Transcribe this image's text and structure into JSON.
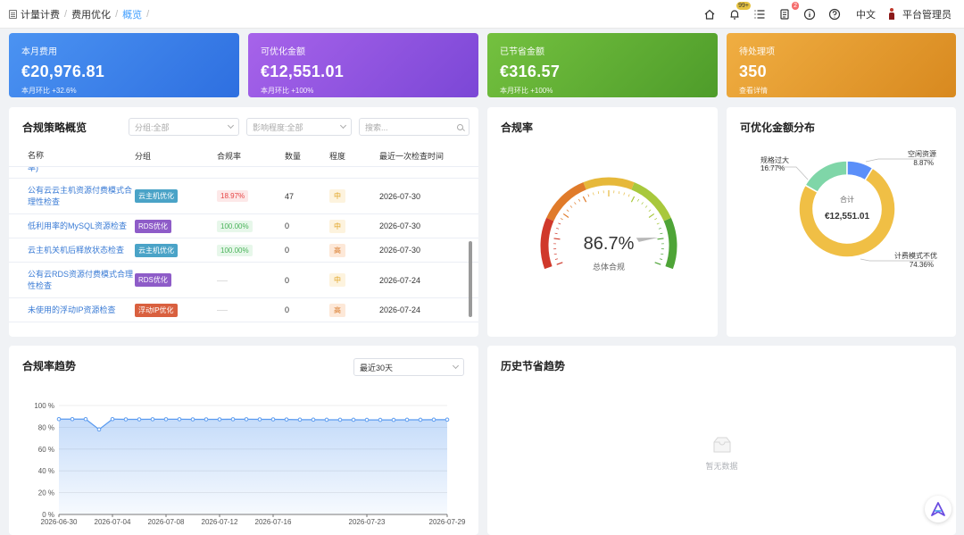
{
  "breadcrumb": {
    "root": "计量计费",
    "mid": "费用优化",
    "current": "概览",
    "sep": "/"
  },
  "header": {
    "badge_bell": "99+",
    "badge_doc": "2",
    "lang": "中文",
    "user": "平台管理员"
  },
  "kpis": [
    {
      "label": "本月费用",
      "value": "€20,976.81",
      "sub": "本月环比 +32.6%"
    },
    {
      "label": "可优化金额",
      "value": "€12,551.01",
      "sub": "本月环比 +100%"
    },
    {
      "label": "已节省金额",
      "value": "€316.57",
      "sub": "本月环比 +100%"
    },
    {
      "label": "待处理项",
      "value": "350",
      "sub": "查看详情"
    }
  ],
  "compliance": {
    "title": "合规策略概览",
    "filter_group": "分组:全部",
    "filter_impact": "影响程度:全部",
    "search_placeholder": "搜索...",
    "columns": [
      "名称",
      "分组",
      "合规率",
      "数量",
      "程度",
      "最近一次检查时间"
    ],
    "rows": [
      {
        "name": "率)",
        "group": "",
        "group_type": "cloud",
        "rate": "",
        "rate_type": "green",
        "count": "",
        "level": "",
        "level_type": "mid",
        "time": ""
      },
      {
        "name": "公有云云主机资源付费模式合理性检查",
        "group": "云主机优化",
        "group_type": "cloud",
        "rate": "18.97%",
        "rate_type": "red",
        "count": "47",
        "level": "中",
        "level_type": "mid",
        "time": "2026-07-30"
      },
      {
        "name": "低利用率的MySQL资源检查",
        "group": "RDS优化",
        "group_type": "rds",
        "rate": "100.00%",
        "rate_type": "green",
        "count": "0",
        "level": "中",
        "level_type": "mid",
        "time": "2026-07-30"
      },
      {
        "name": "云主机关机后释放状态检查",
        "group": "云主机优化",
        "group_type": "cloud",
        "rate": "100.00%",
        "rate_type": "green",
        "count": "0",
        "level": "高",
        "level_type": "high",
        "time": "2026-07-30"
      },
      {
        "name": "公有云RDS资源付费模式合理性检查",
        "group": "RDS优化",
        "group_type": "rds",
        "rate": "",
        "rate_type": "none",
        "count": "0",
        "level": "中",
        "level_type": "mid",
        "time": "2026-07-24"
      },
      {
        "name": "未使用的浮动IP资源检查",
        "group": "浮动IP优化",
        "group_type": "ip",
        "rate": "",
        "rate_type": "none",
        "count": "0",
        "level": "高",
        "level_type": "high",
        "time": "2026-07-24"
      }
    ]
  },
  "gauge": {
    "title": "合规率",
    "value": 86.7,
    "value_text": "86.7%",
    "label": "总体合规"
  },
  "distribution": {
    "title": "可优化金额分布",
    "center_label": "合计",
    "center_value": "€12,551.01",
    "slices": [
      {
        "name": "空闲资源",
        "percent": 8.87,
        "percent_text": "8.87%",
        "color": "#5b8ff9"
      },
      {
        "name": "计费模式不优",
        "percent": 74.36,
        "percent_text": "74.36%",
        "color": "#f0bf45"
      },
      {
        "name": "规格过大",
        "percent": 16.77,
        "percent_text": "16.77%",
        "color": "#7fd6a8"
      }
    ]
  },
  "trend": {
    "title": "合规率趋势",
    "range": "最近30天"
  },
  "history": {
    "title": "历史节省趋势",
    "empty": "暂无数据"
  },
  "chart_data": {
    "type": "area",
    "title": "合规率趋势",
    "xlabel": "",
    "ylabel": "",
    "ylim": [
      0,
      100
    ],
    "y_ticks": [
      "0 %",
      "20 %",
      "40 %",
      "60 %",
      "80 %",
      "100 %"
    ],
    "x_ticks": [
      "2026-06-30",
      "2026-07-04",
      "2026-07-08",
      "2026-07-12",
      "2026-07-16",
      "2026-07-23",
      "2026-07-29"
    ],
    "x": [
      "2026-06-30",
      "2026-07-01",
      "2026-07-02",
      "2026-07-03",
      "2026-07-04",
      "2026-07-05",
      "2026-07-06",
      "2026-07-07",
      "2026-07-08",
      "2026-07-09",
      "2026-07-10",
      "2026-07-11",
      "2026-07-12",
      "2026-07-13",
      "2026-07-14",
      "2026-07-15",
      "2026-07-16",
      "2026-07-17",
      "2026-07-18",
      "2026-07-19",
      "2026-07-20",
      "2026-07-21",
      "2026-07-22",
      "2026-07-23",
      "2026-07-24",
      "2026-07-25",
      "2026-07-26",
      "2026-07-27",
      "2026-07-28",
      "2026-07-29"
    ],
    "series": [
      {
        "values": [
          87.5,
          87.5,
          87.5,
          78,
          87.5,
          87.3,
          87.3,
          87.4,
          87.4,
          87.4,
          87.3,
          87.3,
          87.3,
          87.4,
          87.4,
          87.3,
          87.3,
          87.2,
          87.0,
          87.0,
          86.9,
          86.9,
          86.9,
          86.8,
          86.8,
          86.8,
          86.9,
          86.9,
          87.0,
          87.0
        ]
      }
    ],
    "grid": true,
    "color": "#5b9bf0"
  }
}
